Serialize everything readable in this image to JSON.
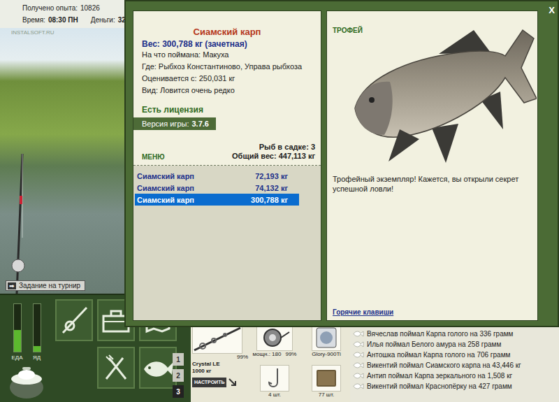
{
  "hud": {
    "experience_label": "Получено опыта:",
    "experience": "10826",
    "time_label": "Время:",
    "time": "08:30 ПН",
    "money_label": "Деньги:",
    "money": "32",
    "watermark": "INSTALSOFT.RU"
  },
  "task_button": {
    "icon": "➡",
    "label": "Задание на турнир"
  },
  "meters": [
    {
      "label": "ЕДА",
      "level": 0.45
    },
    {
      "label": "ЯД",
      "level": 0.12
    }
  ],
  "slots": [
    {
      "label": "1",
      "selected": false
    },
    {
      "label": "2",
      "selected": false
    },
    {
      "label": "3",
      "selected": true
    }
  ],
  "tackle": {
    "rod": {
      "name": "Crystal LE",
      "capacity": "1000 кг",
      "wear": "99%",
      "button": "НАСТРОИТЬ"
    },
    "reel": {
      "power": "мощн.: 180",
      "wear": "99%"
    },
    "line": {
      "name": "Glory-900Ti"
    },
    "hooks": {
      "count": "4 шт."
    },
    "bait": {
      "count": "77 шт."
    }
  },
  "news": [
    "Вячеслав поймал Карпа голого на 336 грамм",
    "Илья поймал Белого амура на 258 грамм",
    "Антошка поймал Карпа голого на 706 грамм",
    "Викентий поймал Сиамского карпа на 43,446 кг",
    "Антип поймал Карпа зеркального на 1,508 кг",
    "Викентий поймал Краснопёрку на 427 грамм"
  ],
  "dialog": {
    "close": "X",
    "fish": {
      "name": "Сиамский карп",
      "weight": "Вес: 300,788 кг (зачетная)",
      "details": [
        "На что поймана: Макуха",
        "Где: Рыбхоз Константиново, Управа рыбхоза",
        "Оценивается с: 250,031 кг",
        "Вид: Ловится очень редко"
      ]
    },
    "license": "Есть лицензия",
    "version_label": "Версия игры:",
    "version": "3.7.6",
    "menu": "МЕНЮ",
    "keepnet": {
      "count": "Рыб в садке: 3",
      "total": "Общий вес: 447,113 кг"
    },
    "catch": [
      {
        "name": "Сиамский карп",
        "weight": "72,193 кг",
        "selected": false
      },
      {
        "name": "Сиамский карп",
        "weight": "74,132 кг",
        "selected": false
      },
      {
        "name": "Сиамский карп",
        "weight": "300,788 кг",
        "selected": true
      }
    ],
    "trophy": {
      "label": "ТРОФЕЙ",
      "message": "Трофейный экземпляр! Кажется, вы открыли секрет успешной ловли!"
    },
    "hotkeys": "Горячие клавиши"
  }
}
